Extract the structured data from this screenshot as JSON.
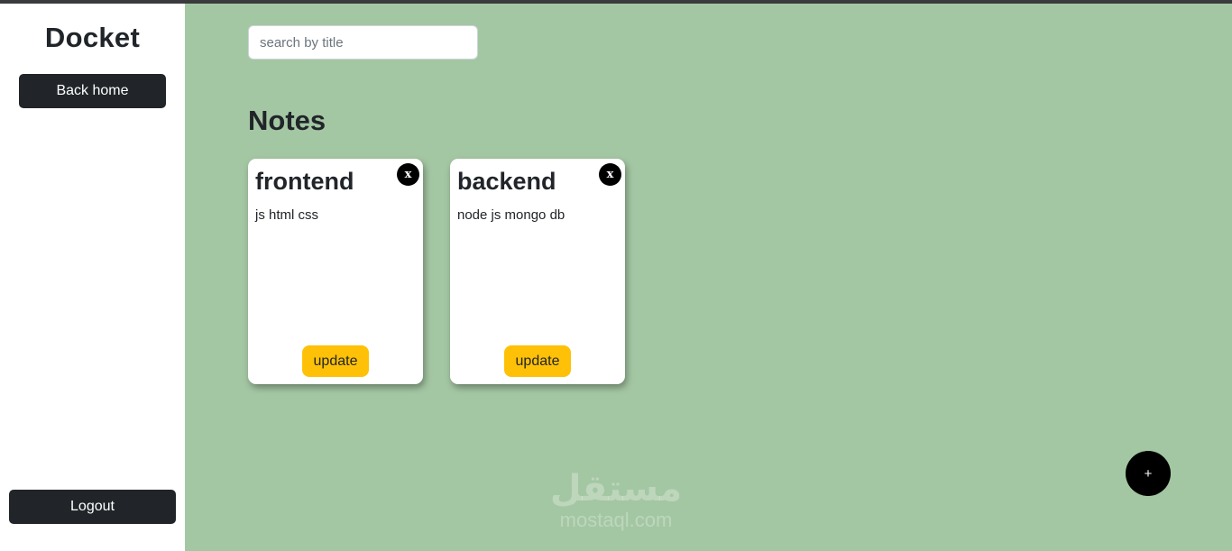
{
  "sidebar": {
    "brand": "Docket",
    "back_home_label": "Back home",
    "logout_label": "Logout"
  },
  "search": {
    "placeholder": "search by title",
    "value": ""
  },
  "main": {
    "title": "Notes",
    "notes": [
      {
        "title": "frontend",
        "body": "js html css",
        "close_glyph": "x",
        "update_label": "update"
      },
      {
        "title": "backend",
        "body": "node js mongo db",
        "close_glyph": "x",
        "update_label": "update"
      }
    ],
    "add_label": "+"
  },
  "watermark": {
    "arabic": "مستقل",
    "latin": "mostaql.com"
  },
  "colors": {
    "main_background": "#a4c7a3",
    "dark_button": "#212529",
    "update_button": "#ffc107",
    "fab": "#000000"
  },
  "icons": {
    "close": "close-icon",
    "add": "plus-icon"
  }
}
